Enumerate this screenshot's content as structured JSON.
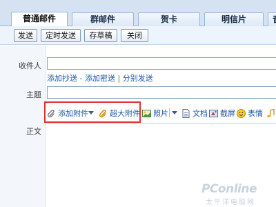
{
  "tabs": [
    {
      "label": "普通邮件",
      "active": true
    },
    {
      "label": "群邮件",
      "active": false
    },
    {
      "label": "贺卡",
      "active": false
    },
    {
      "label": "明信片",
      "active": false
    },
    {
      "label": "音",
      "active": false
    }
  ],
  "toolbar": {
    "send_label": "发送",
    "scheduled_send_label": "定时发送",
    "save_draft_label": "存草稿",
    "close_label": "关闭"
  },
  "form": {
    "recipient_label": "收件人",
    "recipient_value": "",
    "add_cc_label": "添加抄送",
    "dash": "-",
    "add_bcc_label": "添加密送",
    "pipe": "|",
    "separate_send_label": "分别发送",
    "subject_label": "主题",
    "subject_value": "",
    "body_label": "正文"
  },
  "attach_toolbar": {
    "add_attachment_label": "添加附件",
    "super_attachment_label": "超大附件",
    "photo_label": "照片",
    "document_label": "文档",
    "screenshot_label": "截屏",
    "emoji_label": "表情"
  },
  "highlight_color": "#e03030",
  "link_color": "#1b55a8",
  "watermark": {
    "brand": "PConline",
    "subtitle": "太平洋电脑网"
  }
}
